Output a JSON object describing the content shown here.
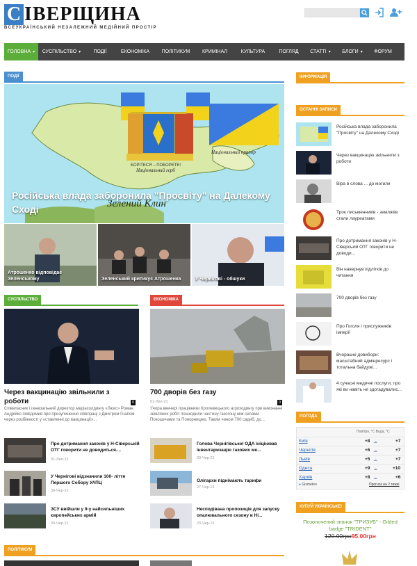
{
  "logo": {
    "first": "С",
    "rest": "ІВЕРЩИНА",
    "tagline": "ВСЕУКРАЇНСЬКИЙ НЕЗАЛЕЖНИЙ МЕДІЙНИЙ ПРОСТІР"
  },
  "header_icons": [
    "search-icon",
    "login-icon",
    "add-user-icon"
  ],
  "nav": [
    {
      "label": "ГОЛОВНА",
      "caret": true
    },
    {
      "label": "СУСПІЛЬСТВО",
      "caret": true
    },
    {
      "label": "ПОДІЇ",
      "caret": false
    },
    {
      "label": "ЕКОНОМІКА",
      "caret": false
    },
    {
      "label": "ПОЛІТИКУМ",
      "caret": false
    },
    {
      "label": "КРИМІНАЛ",
      "caret": false
    },
    {
      "label": "КУЛЬТУРА",
      "caret": false
    },
    {
      "label": "ПОГЛЯД",
      "caret": false
    },
    {
      "label": "СТАТТІ",
      "caret": true
    },
    {
      "label": "БЛОГИ",
      "caret": true
    },
    {
      "label": "ФОРУМ",
      "caret": false
    }
  ],
  "colors": {
    "green": "#5cae3a",
    "blue": "#4a8fd0",
    "red": "#e0463a",
    "orange": "#f0a020",
    "nav_bg": "#444444"
  },
  "sections": {
    "podii": "ПОДІЇ",
    "suspilstvo": "СУСПІЛЬСТВО",
    "ekonomika": "ЕКОНОМІКА",
    "politykum": "ПОЛІТИКУМ",
    "informatsiia": "ІНФОРМАЦІЯ",
    "ostanni": "ОСТАННІ ЗАПИСИ",
    "pohoda": "ПОГОДА",
    "kupui": "КУПУЙ УКРАЇНСЬКЕ!"
  },
  "hero": {
    "title": "Російська влада заборонила \"Просвіту\" на Далекому Сході",
    "map_labels": {
      "motto": "БОРІТЕСЯ – ПОБОРЕТЕ!",
      "coat": "Національний герб",
      "flag": "Національний прапор",
      "region": "Зелений Клин"
    }
  },
  "hero_thumbs": [
    {
      "caption": "Атрошенко відповідає Зеленському"
    },
    {
      "caption": "Зеленський критикує Атрошенка"
    },
    {
      "caption": "У Чернігові - обшуки"
    }
  ],
  "col_left": {
    "title": "Через вакцинацію звільнили з роботи",
    "date": "01-Лип-21",
    "comments": "0",
    "excerpt": "Співвласник і генеральний директор медіахолдингу «Люкс» Роман Андрійко повідомив про призупинення співпраці з Дмитром Гнапом через розбіжності у «ставленні до вакцинації»...",
    "items": [
      {
        "title": "Про дотримання законів у Н-Сіверській ОТГ говорити не доводиться....",
        "date": "01-Лип-21"
      },
      {
        "title": "У Чернігові відзначили 100- ліття Першого Собору УАПЦ",
        "date": "30-Чер-21"
      },
      {
        "title": "ЗСУ ввійшли у 9-у найсильніших європейських армій",
        "date": "30-Чер-21"
      }
    ]
  },
  "col_right": {
    "title": "700 дворів без газу",
    "date": "01-Лип-21",
    "comments": "0",
    "excerpt": "Учора ввечері працівники Кролевецького агроходингу при виконанні земляних робіт пошкодили частину газогону між селами Покошичами та Понорницею. Таким чином 700 садиб, до...",
    "items": [
      {
        "title": "Голова Чернігівської ОДА ініціював інвентаризацію газових ме...",
        "date": "30-Чер-21"
      },
      {
        "title": "Олігархи піднімають тарифи",
        "date": "27-Чер-21"
      },
      {
        "title": "Несподівана пропозиція для запуску опалювального сезону в Ні...",
        "date": "23-Чер-21"
      }
    ]
  },
  "sidebar_latest": [
    "Російська влада заборонила \"Просвіту\" на Далекому Сході",
    "Через вакцинацію звільнили з роботи",
    "Віра в слова ... до могили",
    "Троє письменників - земляків стали лауреатами",
    "Про дотримання законів у Н-Сіверській ОТГ говорити не доводи...",
    "Він навернув підлітків до читання",
    "700 дворів без газу",
    "Про Гоголя і прислужників імперії",
    "Вчорашні довибори: масштабний адмінресурс і тотальна байдужі...",
    "4 сучасні медичні послуги, про які ви навіть не здогадувалис..."
  ],
  "weather": {
    "header": "Повітря, °C   Вода, °C",
    "rows": [
      {
        "city": "Київ",
        "air": "+8",
        "water": "+7"
      },
      {
        "city": "Чернігів",
        "air": "+6",
        "water": "+7"
      },
      {
        "city": "Львів",
        "air": "+5",
        "water": "+7"
      },
      {
        "city": "Одеса",
        "air": "+9",
        "water": "+10"
      },
      {
        "city": "Харків",
        "air": "+8",
        "water": "+6"
      }
    ],
    "source": "Gismeteo",
    "forecast_link": "Прогноз на 2 тижні"
  },
  "shop": {
    "title": "Позолочений значок \"ТРИЗУБ\" - Gilded badge \"TRIDENT\"",
    "old_price": "120.00грн",
    "new_price": "95.00грн"
  }
}
